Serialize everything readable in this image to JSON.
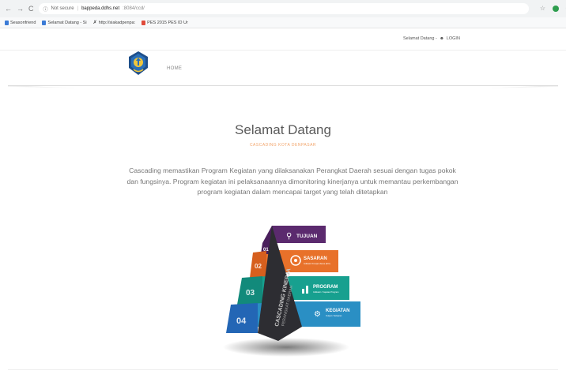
{
  "browser": {
    "back": "←",
    "forward": "→",
    "reload": "C",
    "security_label": "Not secure",
    "url_host": "bappeda.ddhs.net",
    "url_path": ":8084/ccd/",
    "star": "☆"
  },
  "bookmarks": [
    {
      "label": "Seasonfriend",
      "color": "#3b7bd6"
    },
    {
      "label": "Selamat Datang - Si",
      "color": "#3b7bd6"
    },
    {
      "label": "http://siakadpenpa:",
      "color": "#333333"
    },
    {
      "label": "PES 2015 PES ID Ur",
      "color": "#e04a3a"
    }
  ],
  "top_strip": {
    "welcome_menu": "Selamat Datang -",
    "login_icon": "user-icon",
    "login_label": "LOGIN"
  },
  "header": {
    "nav_home": "HOME"
  },
  "hero": {
    "title": "Selamat Datang",
    "subtitle": "CASCADING KOTA DENPASAR",
    "description": "Cascading memastikan Program Kegiatan yang dilaksanakan Perangkat Daerah sesuai dengan tugas pokok dan fungsinya. Program kegiatan ini pelaksanaannya dimonitoring kinerjanya untuk memantau perkembangan program kegiatan dalam mencapai target yang telah ditetapkan"
  },
  "pyramid": {
    "side_title_1": "CASCADING KINERJA",
    "side_title_2": "PERANGKAT DAERAH",
    "levels": [
      {
        "number": "01",
        "label": "TUJUAN",
        "sub": "",
        "color": "#5b2a6e"
      },
      {
        "number": "02",
        "label": "SASARAN",
        "sub": "Indikator Kinerja Utama (IKU)",
        "color": "#e8712a"
      },
      {
        "number": "03",
        "label": "PROGRAM",
        "sub": "Indikator / Capaian Program",
        "color": "#17a08f"
      },
      {
        "number": "04",
        "label": "KEGIATAN",
        "sub": "Output / Keluaran",
        "color": "#2a8fc4"
      }
    ]
  },
  "colors": {
    "accent_orange": "#f2a46a",
    "text_gray": "#777777"
  }
}
